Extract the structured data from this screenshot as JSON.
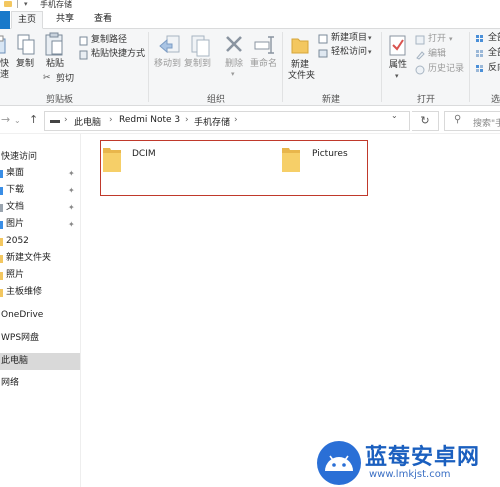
{
  "window": {
    "title": "手机存储"
  },
  "tabs": {
    "home": "主页",
    "share": "共享",
    "view": "查看"
  },
  "ribbon": {
    "clipboard": {
      "group_label": "剪贴板",
      "pin_quick_access": "快",
      "copy": "复制",
      "paste": "粘贴",
      "copy_path": "复制路径",
      "paste_shortcut": "粘贴快捷方式",
      "cut": "剪切"
    },
    "organize": {
      "group_label": "组织",
      "move_to": "移动到",
      "copy_to": "复制到",
      "delete": "删除",
      "rename": "重命名"
    },
    "new": {
      "group_label": "新建",
      "new_folder_line1": "新建",
      "new_folder_line2": "文件夹",
      "new_item": "新建项目",
      "easy_access": "轻松访问"
    },
    "open": {
      "group_label": "打开",
      "properties": "属性",
      "open": "打开",
      "edit": "编辑",
      "history": "历史记录"
    },
    "select": {
      "group_label": "选",
      "select_all": "全部",
      "select_none": "全部",
      "invert": "反向"
    }
  },
  "address": {
    "crumbs": [
      "此电脑",
      "Redmi Note 3",
      "手机存储"
    ],
    "search_placeholder": "搜索\"手"
  },
  "sidebar": {
    "quick_access": "快速访问",
    "items": [
      {
        "label": "桌面",
        "pinned": true
      },
      {
        "label": "下载",
        "pinned": true
      },
      {
        "label": "文档",
        "pinned": true
      },
      {
        "label": "图片",
        "pinned": true
      },
      {
        "label": "2052",
        "pinned": false
      },
      {
        "label": "新建文件夹",
        "pinned": false
      },
      {
        "label": "照片",
        "pinned": false
      },
      {
        "label": "主板维修",
        "pinned": false
      }
    ],
    "onedrive": "OneDrive",
    "wps": "WPS网盘",
    "this_pc": "此电脑",
    "network": "网络"
  },
  "content": {
    "files": [
      {
        "name": "DCIM",
        "type": "folder"
      },
      {
        "name": "Pictures",
        "type": "folder"
      }
    ]
  },
  "watermark": {
    "brand": "蓝莓安卓网",
    "url": "www.lmkjst.com"
  },
  "colors": {
    "accent": "#1979ca",
    "folder": "#f3c760",
    "highlight_border": "#c0392b",
    "selected_bg": "#d9d9d9",
    "watermark_blue": "#1a5fbf"
  },
  "icons": {
    "pin": "pin-icon",
    "copy": "copy-icon",
    "paste": "paste-icon",
    "copy_path": "copy-path-icon",
    "paste_shortcut": "paste-shortcut-icon",
    "cut": "scissors-icon",
    "move_to": "move-to-icon",
    "copy_to": "copy-to-icon",
    "delete": "delete-x-icon",
    "rename": "rename-icon",
    "new_folder": "new-folder-icon",
    "new_item": "new-item-icon",
    "easy_access": "easy-access-icon",
    "properties": "properties-check-icon",
    "open": "open-icon",
    "edit": "edit-icon",
    "history": "history-icon",
    "select_all": "select-all-icon",
    "refresh": "refresh-icon",
    "search": "search-icon"
  }
}
